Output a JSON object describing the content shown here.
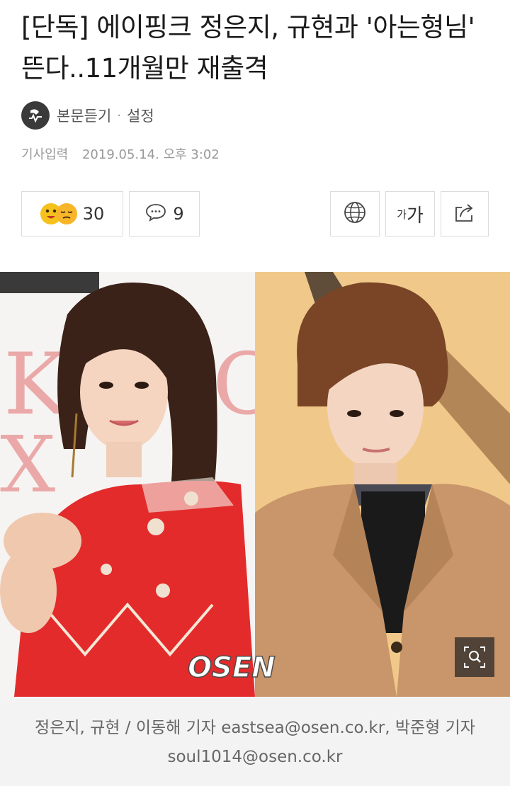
{
  "article": {
    "headline": "[단독] 에이핑크 정은지, 규현과 '아는형님' 뜬다..11개월만 재출격",
    "listen_label": "본문듣기",
    "separator": "·",
    "settings_label": "설정",
    "date_label": "기사입력",
    "date_value": "2019.05.14. 오후 3:02"
  },
  "actions": {
    "reaction_count": "30",
    "comment_count": "9",
    "font_size_small": "가",
    "font_size_large": "가"
  },
  "photo": {
    "watermark": "OSEN",
    "caption": "정은지, 규현 / 이동해 기자 eastsea@osen.co.kr, 박준형 기자 soul1014@osen.co.kr"
  },
  "colors": {
    "emoji": "#f5c11b",
    "left_bg": "#ffffff",
    "right_bg": "#f0c98a",
    "dress": "#e32b2b",
    "coat": "#c9956a"
  },
  "icons": [
    "listen-icon",
    "reaction-emoji-icon",
    "comment-icon",
    "globe-icon",
    "share-icon",
    "zoom-icon"
  ]
}
